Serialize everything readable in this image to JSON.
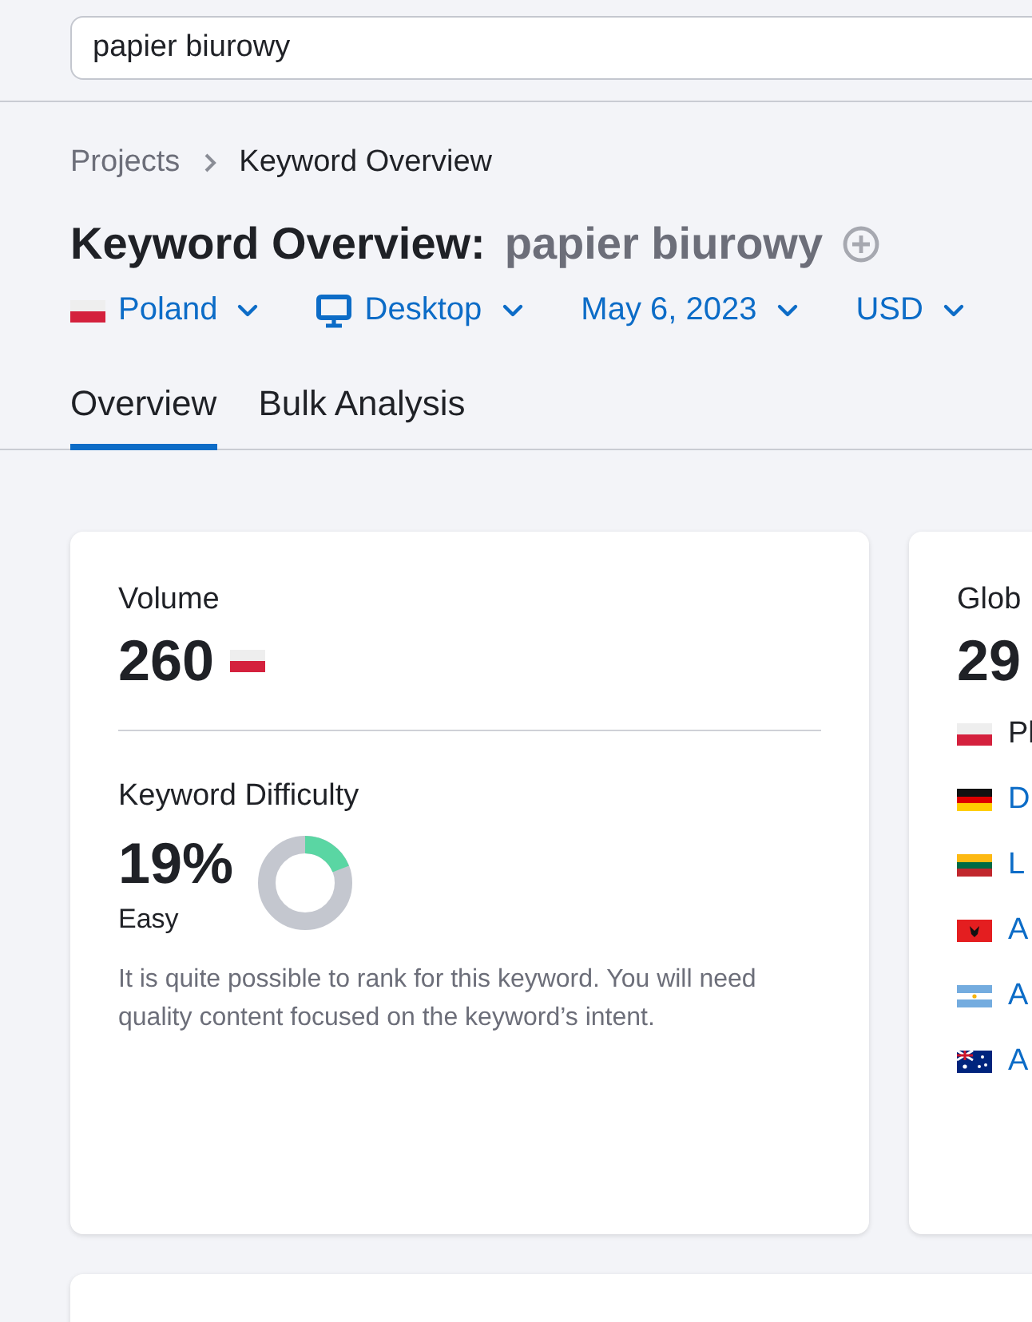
{
  "search": {
    "value": "papier biurowy"
  },
  "breadcrumbs": [
    "Projects",
    "Keyword Overview"
  ],
  "title": {
    "label": "Keyword Overview:",
    "keyword": "papier biurowy"
  },
  "filters": [
    {
      "kind": "country",
      "label": "Poland"
    },
    {
      "kind": "device",
      "label": "Desktop"
    },
    {
      "kind": "plain",
      "label": "May 6, 2023"
    },
    {
      "kind": "plain",
      "label": "USD"
    }
  ],
  "tabs": [
    {
      "label": "Overview",
      "selected": true
    },
    {
      "label": "Bulk Analysis",
      "selected": false
    }
  ],
  "volume_card": {
    "label": "Volume",
    "value": "260",
    "difficulty_label": "Keyword Difficulty",
    "difficulty_value": "19%",
    "difficulty_rating": "Easy",
    "level": 0.19,
    "description": "It is quite possible to rank for this keyword. You will need quality content focused on the keyword’s intent."
  },
  "global_card": {
    "label": "Glob",
    "value": "29",
    "countries": [
      {
        "kind": "poland",
        "name": "Pl",
        "selected": true
      },
      {
        "kind": "germany",
        "name": "D",
        "selected": false
      },
      {
        "kind": "lithuania",
        "name": "L",
        "selected": false
      },
      {
        "kind": "albania",
        "name": "A",
        "selected": false
      },
      {
        "kind": "argentina",
        "name": "A",
        "selected": false
      },
      {
        "kind": "australia",
        "name": "A",
        "selected": false
      }
    ]
  }
}
